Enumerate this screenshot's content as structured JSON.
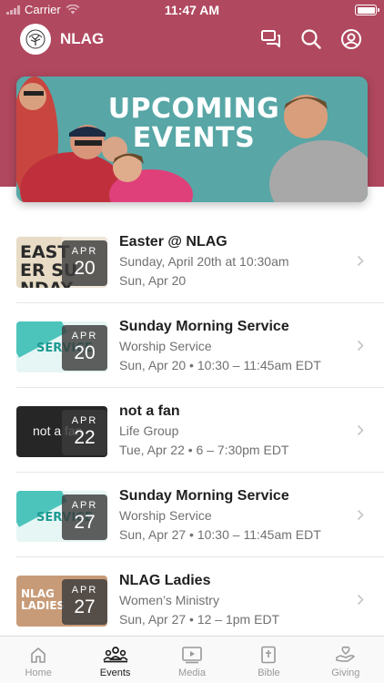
{
  "status_bar": {
    "carrier": "Carrier",
    "time": "11:47 AM"
  },
  "app": {
    "title": "NLAG"
  },
  "banner": {
    "line1": "UPCOMING",
    "line2": "EVENTS"
  },
  "events": [
    {
      "title": "Easter @ NLAG",
      "subtitle": "Sunday, April 20th at 10:30am",
      "when": "Sun, Apr 20",
      "month": "APR",
      "day": "20",
      "thumb_text": "EASTER SUNDAY"
    },
    {
      "title": "Sunday Morning Service",
      "subtitle": "Worship Service",
      "when": "Sun, Apr 20 • 10:30 – 11:45am EDT",
      "month": "APR",
      "day": "20",
      "thumb_text": "SERVICE"
    },
    {
      "title": "not a fan",
      "subtitle": "Life Group",
      "when": "Tue, Apr 22 • 6 – 7:30pm EDT",
      "month": "APR",
      "day": "22",
      "thumb_text": "not a fan"
    },
    {
      "title": "Sunday Morning Service",
      "subtitle": "Worship Service",
      "when": "Sun, Apr 27 • 10:30 – 11:45am EDT",
      "month": "APR",
      "day": "27",
      "thumb_text": "SERVICE"
    },
    {
      "title": "NLAG Ladies",
      "subtitle": "Women’s Ministry",
      "when": "Sun, Apr 27 • 12 – 1pm EDT",
      "month": "APR",
      "day": "27",
      "thumb_text": "NLAG LADIES"
    }
  ],
  "tabs": [
    {
      "label": "Home",
      "icon": "home-icon"
    },
    {
      "label": "Events",
      "icon": "people-icon"
    },
    {
      "label": "Media",
      "icon": "play-icon"
    },
    {
      "label": "Bible",
      "icon": "bible-icon"
    },
    {
      "label": "Giving",
      "icon": "heart-hand-icon"
    }
  ],
  "colors": {
    "header": "#b0485f",
    "banner": "#58a6a6"
  }
}
